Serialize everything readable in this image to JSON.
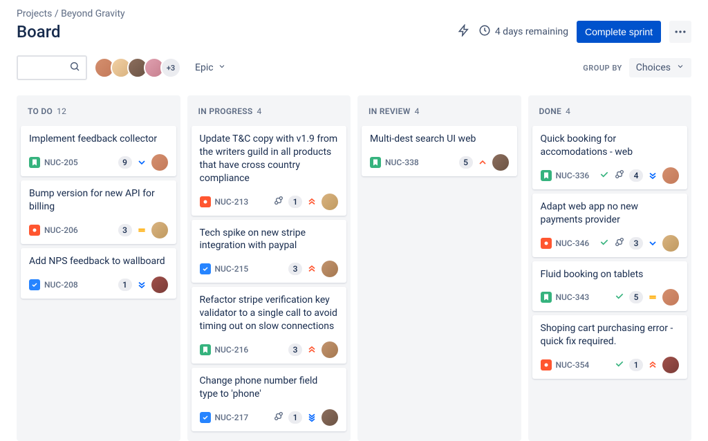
{
  "breadcrumb": {
    "root": "Projects",
    "project": "Beyond Gravity"
  },
  "page_title": "Board",
  "sprint": {
    "remaining": "4 days remaining",
    "complete_label": "Complete sprint"
  },
  "toolbar": {
    "search_placeholder": "",
    "epic_label": "Epic",
    "avatar_more": "+3",
    "group_by_label": "GROUP BY",
    "group_by_value": "Choices",
    "avatars": [
      {
        "bg": "linear-gradient(135deg,#d48f6e,#c47a5a)"
      },
      {
        "bg": "linear-gradient(135deg,#f2d0a4,#d9b380)"
      },
      {
        "bg": "linear-gradient(135deg,#8c6e5d,#6b5344)"
      },
      {
        "bg": "linear-gradient(135deg,#e0a0b0,#c7808f)"
      }
    ]
  },
  "columns": [
    {
      "title": "TO DO",
      "count": "12",
      "cards": [
        {
          "title": "Implement feedback collector",
          "type": "story",
          "key": "NUC-205",
          "story_points": "9",
          "priority": "low-single",
          "avatar": "linear-gradient(135deg,#d48f6e,#c47a5a)"
        },
        {
          "title": "Bump version for new API for billing",
          "type": "bug",
          "key": "NUC-206",
          "story_points": "3",
          "priority": "medium",
          "avatar": "linear-gradient(135deg,#d9b380,#c09a60)"
        },
        {
          "title": "Add NPS feedback to wallboard",
          "type": "task",
          "key": "NUC-208",
          "story_points": "1",
          "priority": "low",
          "avatar": "linear-gradient(135deg,#a0504a,#7a3c38)"
        }
      ]
    },
    {
      "title": "IN PROGRESS",
      "count": "4",
      "cards": [
        {
          "title": "Update T&C copy with v1.9 from the writers guild in all products that have cross country compliance",
          "type": "bug",
          "key": "NUC-213",
          "story_points": "1",
          "priority": "highest",
          "has_subtask": true,
          "avatar": "linear-gradient(135deg,#d9b380,#c09a60)"
        },
        {
          "title": "Tech spike on new stripe integration with paypal",
          "type": "task",
          "key": "NUC-215",
          "story_points": "3",
          "priority": "highest",
          "avatar": "linear-gradient(135deg,#c2946e,#a57850)"
        },
        {
          "title": "Refactor stripe verification key validator to a single call to avoid timing out on slow connections",
          "type": "story",
          "key": "NUC-216",
          "story_points": "3",
          "priority": "highest",
          "avatar": "linear-gradient(135deg,#c2946e,#a57850)"
        },
        {
          "title": "Change phone number field type to 'phone'",
          "type": "task",
          "key": "NUC-217",
          "story_points": "1",
          "priority": "lowest",
          "has_subtask": true,
          "avatar": "linear-gradient(135deg,#8c6e5d,#6b5344)"
        }
      ]
    },
    {
      "title": "IN REVIEW",
      "count": "4",
      "cards": [
        {
          "title": "Multi-dest search UI web",
          "type": "story",
          "key": "NUC-338",
          "story_points": "5",
          "priority": "high-single",
          "avatar": "linear-gradient(135deg,#8c6e5d,#6b5344)"
        }
      ]
    },
    {
      "title": "DONE",
      "count": "4",
      "cards": [
        {
          "title": "Quick booking for accomodations - web",
          "type": "story",
          "key": "NUC-336",
          "story_points": "4",
          "priority": "low",
          "done": true,
          "has_subtask": true,
          "avatar": "linear-gradient(135deg,#d48f6e,#c47a5a)"
        },
        {
          "title": "Adapt web app no new payments provider",
          "type": "bug",
          "key": "NUC-346",
          "story_points": "3",
          "priority": "low-single",
          "done": true,
          "has_subtask": true,
          "avatar": "linear-gradient(135deg,#d9b380,#c09a60)"
        },
        {
          "title": "Fluid booking on tablets",
          "type": "story",
          "key": "NUC-343",
          "story_points": "5",
          "priority": "medium",
          "done": true,
          "avatar": "linear-gradient(135deg,#d48f6e,#c47a5a)"
        },
        {
          "title": "Shoping cart purchasing error - quick fix required.",
          "type": "bug",
          "key": "NUC-354",
          "story_points": "1",
          "priority": "highest",
          "done": true,
          "avatar": "linear-gradient(135deg,#a0504a,#7a3c38)"
        }
      ]
    }
  ]
}
